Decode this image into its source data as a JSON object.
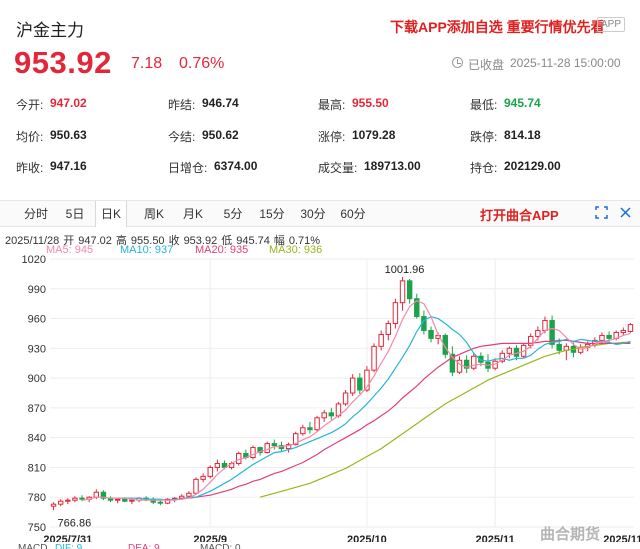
{
  "header": {
    "title": "沪金主力",
    "promo": "下载APP添加自选 重要行情优先看",
    "app_badge": "APP",
    "price": "953.92",
    "change": "7.18",
    "change_pct": "0.76%",
    "status": "已收盘",
    "time": "2025-11-28 15:00:00"
  },
  "stats": [
    {
      "label": "今开:",
      "value": "947.02",
      "color": "red"
    },
    {
      "label": "昨结:",
      "value": "946.74",
      "color": "dark"
    },
    {
      "label": "最高:",
      "value": "955.50",
      "color": "red"
    },
    {
      "label": "最低:",
      "value": "945.74",
      "color": "green"
    },
    {
      "label": "均价:",
      "value": "950.63",
      "color": "dark"
    },
    {
      "label": "今结:",
      "value": "950.62",
      "color": "dark"
    },
    {
      "label": "涨停:",
      "value": "1079.28",
      "color": "dark"
    },
    {
      "label": "跌停:",
      "value": "814.18",
      "color": "dark"
    },
    {
      "label": "昨收:",
      "value": "947.16",
      "color": "dark"
    },
    {
      "label": "日增仓:",
      "value": "6374.00",
      "color": "dark"
    },
    {
      "label": "成交量:",
      "value": "189713.00",
      "color": "dark"
    },
    {
      "label": "持仓:",
      "value": "202129.00",
      "color": "dark"
    }
  ],
  "periods": [
    "分时",
    "5日",
    "日K",
    "周K",
    "月K",
    "5分",
    "15分",
    "30分",
    "60分"
  ],
  "active_period": "日K",
  "open_app": "打开曲合APP",
  "kline_info": {
    "date": "2025/11/28",
    "open_label": "开",
    "open": "947.02",
    "high_label": "高",
    "high": "955.50",
    "close_label": "收",
    "close": "953.92",
    "low_label": "低",
    "low": "945.74",
    "amp_label": "幅",
    "amp": "0.71%"
  },
  "ma_legend": [
    {
      "text": "MA5: 945",
      "color": "#f28aa8"
    },
    {
      "text": "MA10: 937",
      "color": "#27b5d6"
    },
    {
      "text": "MA20: 935",
      "color": "#e0407a"
    },
    {
      "text": "MA30: 936",
      "color": "#9ab51d"
    }
  ],
  "macd_legend": [
    {
      "text": "MACD",
      "color": "#555555"
    },
    {
      "text": "DIF: 9",
      "color": "#27b5d6"
    },
    {
      "text": "DEA: 9",
      "color": "#e0407a"
    },
    {
      "text": "MACD: 0",
      "color": "#555555"
    }
  ],
  "watermark": "曲合期货",
  "colors": {
    "up": "#e3273a",
    "down": "#1aa34a",
    "grid": "#eeeeee",
    "ma5": "#f28aa8",
    "ma10": "#27b5d6",
    "ma20": "#e0407a",
    "ma30": "#9ab51d"
  },
  "chart_data": {
    "type": "candlestick",
    "ylim": [
      750,
      1020
    ],
    "yticks": [
      1020,
      990,
      960,
      930,
      900,
      870,
      840,
      810,
      780,
      750
    ],
    "xticks": [
      {
        "label": "2025/7/31",
        "index": 2
      },
      {
        "label": "2025/9",
        "index": 22
      },
      {
        "label": "2025/10",
        "index": 44
      },
      {
        "label": "2025/11",
        "index": 62
      },
      {
        "label": "2025/11/28",
        "index": 81
      }
    ],
    "annotations": [
      {
        "text": "1001.96",
        "type": "max",
        "index": 49
      },
      {
        "text": "766.86",
        "type": "min",
        "index": 0
      }
    ],
    "ohlc": [
      [
        771,
        775,
        766.86,
        773
      ],
      [
        773,
        778,
        771,
        776
      ],
      [
        776,
        779,
        773,
        777
      ],
      [
        777,
        781,
        775,
        779
      ],
      [
        779,
        782,
        776,
        778
      ],
      [
        778,
        781,
        775,
        780
      ],
      [
        780,
        788,
        778,
        785
      ],
      [
        785,
        787,
        777,
        779
      ],
      [
        779,
        781,
        775,
        777
      ],
      [
        777,
        779,
        774,
        778
      ],
      [
        778,
        780,
        775,
        776
      ],
      [
        776,
        779,
        773,
        777
      ],
      [
        777,
        780,
        775,
        779
      ],
      [
        779,
        781,
        776,
        778
      ],
      [
        778,
        780,
        773,
        775
      ],
      [
        775,
        777,
        772,
        774
      ],
      [
        774,
        779,
        773,
        778
      ],
      [
        778,
        780,
        775,
        779
      ],
      [
        779,
        783,
        778,
        781
      ],
      [
        781,
        786,
        780,
        784
      ],
      [
        784,
        800,
        783,
        798
      ],
      [
        798,
        804,
        795,
        801
      ],
      [
        801,
        812,
        799,
        810
      ],
      [
        810,
        818,
        806,
        814
      ],
      [
        814,
        817,
        808,
        810
      ],
      [
        810,
        816,
        808,
        814
      ],
      [
        814,
        826,
        812,
        824
      ],
      [
        824,
        828,
        818,
        820
      ],
      [
        820,
        832,
        818,
        830
      ],
      [
        830,
        831,
        822,
        825
      ],
      [
        825,
        836,
        824,
        834
      ],
      [
        834,
        838,
        828,
        832
      ],
      [
        832,
        836,
        826,
        829
      ],
      [
        829,
        835,
        825,
        833
      ],
      [
        833,
        846,
        832,
        844
      ],
      [
        844,
        853,
        842,
        850
      ],
      [
        850,
        856,
        844,
        848
      ],
      [
        848,
        862,
        846,
        860
      ],
      [
        860,
        868,
        856,
        865
      ],
      [
        865,
        870,
        858,
        862
      ],
      [
        862,
        876,
        860,
        874
      ],
      [
        874,
        888,
        872,
        885
      ],
      [
        885,
        904,
        882,
        900
      ],
      [
        900,
        905,
        884,
        888
      ],
      [
        888,
        912,
        886,
        908
      ],
      [
        908,
        935,
        906,
        932
      ],
      [
        932,
        948,
        928,
        944
      ],
      [
        944,
        958,
        938,
        955
      ],
      [
        955,
        980,
        950,
        976
      ],
      [
        976,
        1001.96,
        968,
        998
      ],
      [
        998,
        1000,
        975,
        980
      ],
      [
        980,
        985,
        960,
        962
      ],
      [
        962,
        968,
        944,
        948
      ],
      [
        948,
        952,
        936,
        940
      ],
      [
        940,
        946,
        934,
        943
      ],
      [
        943,
        945,
        920,
        924
      ],
      [
        924,
        932,
        902,
        906
      ],
      [
        906,
        922,
        904,
        918
      ],
      [
        918,
        923,
        905,
        910
      ],
      [
        910,
        925,
        908,
        922
      ],
      [
        922,
        926,
        912,
        916
      ],
      [
        916,
        924,
        906,
        910
      ],
      [
        910,
        920,
        908,
        917
      ],
      [
        917,
        928,
        915,
        925
      ],
      [
        925,
        932,
        920,
        930
      ],
      [
        930,
        933,
        918,
        922
      ],
      [
        922,
        935,
        920,
        933
      ],
      [
        933,
        945,
        930,
        942
      ],
      [
        942,
        952,
        938,
        948
      ],
      [
        948,
        962,
        945,
        958
      ],
      [
        958,
        963,
        930,
        934
      ],
      [
        934,
        940,
        924,
        928
      ],
      [
        928,
        935,
        918,
        932
      ],
      [
        932,
        936,
        921,
        926
      ],
      [
        926,
        934,
        924,
        931
      ],
      [
        931,
        937,
        927,
        934
      ],
      [
        934,
        941,
        931,
        938
      ],
      [
        938,
        946,
        934,
        943
      ],
      [
        943,
        947,
        936,
        940
      ],
      [
        940,
        948,
        938,
        946
      ],
      [
        946,
        951,
        943,
        948
      ],
      [
        947.02,
        955.5,
        945.74,
        953.92
      ]
    ],
    "ma5": [
      null,
      null,
      null,
      null,
      777,
      778,
      780,
      780,
      779,
      779,
      779,
      778,
      777,
      777,
      777,
      777,
      777,
      777,
      778,
      779,
      783,
      788,
      795,
      803,
      809,
      814,
      818,
      820,
      823,
      826,
      828,
      831,
      831,
      832,
      834,
      838,
      841,
      846,
      852,
      857,
      862,
      868,
      876,
      883,
      891,
      902,
      915,
      927,
      942,
      959,
      972,
      978,
      975,
      962,
      944,
      931,
      921,
      914,
      911,
      913,
      914,
      913,
      914,
      918,
      923,
      925,
      927,
      932,
      940,
      948,
      950,
      948,
      941,
      934,
      929,
      931,
      934,
      937,
      938,
      940,
      943,
      945
    ],
    "ma10": [
      null,
      null,
      null,
      null,
      null,
      null,
      null,
      null,
      null,
      779,
      779,
      779,
      779,
      778,
      778,
      778,
      777,
      778,
      778,
      780,
      780,
      783,
      786,
      790,
      794,
      798,
      803,
      808,
      813,
      817,
      821,
      825,
      826,
      828,
      830,
      833,
      836,
      839,
      842,
      845,
      849,
      854,
      861,
      867,
      874,
      882,
      890,
      899,
      910,
      921,
      933,
      947,
      958,
      962,
      960,
      955,
      949,
      944,
      936,
      925,
      918,
      917,
      919,
      920,
      918,
      920,
      920,
      923,
      929,
      934,
      936,
      937,
      939,
      937,
      939,
      938,
      937,
      937,
      936,
      934,
      935,
      937
    ],
    "ma20": [
      null,
      null,
      null,
      null,
      null,
      null,
      null,
      null,
      null,
      null,
      null,
      null,
      null,
      null,
      null,
      null,
      null,
      null,
      null,
      779,
      780,
      781,
      782,
      784,
      786,
      788,
      791,
      793,
      796,
      798,
      801,
      804,
      806,
      809,
      812,
      815,
      819,
      823,
      828,
      832,
      836,
      840,
      844,
      848,
      853,
      857,
      862,
      867,
      873,
      880,
      886,
      892,
      899,
      905,
      911,
      916,
      921,
      924,
      927,
      930,
      932,
      933,
      934,
      935,
      935,
      935,
      935,
      935,
      936,
      937,
      937,
      938,
      938,
      937,
      936,
      935,
      935,
      935,
      935,
      935,
      935,
      935
    ],
    "ma30": [
      null,
      null,
      null,
      null,
      null,
      null,
      null,
      null,
      null,
      null,
      null,
      null,
      null,
      null,
      null,
      null,
      null,
      null,
      null,
      null,
      null,
      null,
      null,
      null,
      null,
      null,
      null,
      null,
      null,
      780,
      782,
      784,
      786,
      788,
      790,
      792,
      794,
      797,
      800,
      803,
      806,
      809,
      813,
      817,
      821,
      825,
      829,
      834,
      839,
      844,
      849,
      854,
      859,
      864,
      869,
      874,
      878,
      882,
      886,
      890,
      894,
      898,
      901,
      904,
      907,
      910,
      913,
      916,
      919,
      922,
      924,
      926,
      928,
      929,
      931,
      932,
      933,
      934,
      935,
      935,
      936,
      936
    ]
  }
}
